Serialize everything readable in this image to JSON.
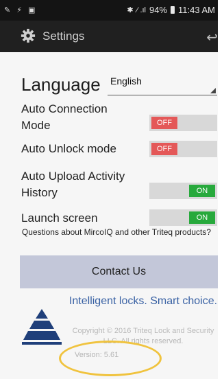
{
  "status_bar": {
    "left_icons": "✎ ⚡ ▣",
    "bluetooth": "✱",
    "signal": "⁄ .ıl",
    "battery_percent": "94%",
    "time": "11:43 AM"
  },
  "app_bar": {
    "title": "Settings",
    "icon": "gear-icon",
    "back_icon": "back-arrow-icon"
  },
  "language": {
    "label": "Language",
    "value": "English"
  },
  "settings": [
    {
      "label_line1": "Auto Connection",
      "label_line2": "Mode",
      "state": "OFF"
    },
    {
      "label_line1": "Auto Unlock mode",
      "label_line2": "",
      "state": "OFF"
    },
    {
      "label_line1": "Auto Upload Activity",
      "label_line2": "History",
      "state": "ON"
    },
    {
      "label_line1": "Launch screen",
      "label_line2": "",
      "state": "ON"
    }
  ],
  "questions_text": "Questions about MircoIQ and other Triteq products?",
  "contact_button": "Contact Us",
  "tagline": "Intelligent locks. Smart choice.",
  "copyright": "Copyright © 2016 Triteq Lock and Security LLC. All rights reserved.",
  "version": "Version: 5.61",
  "colors": {
    "off": "#e45858",
    "on": "#27a93c",
    "contact_bg": "#c3c7d9",
    "tagline": "#3a62a4",
    "highlight": "#f0c33e"
  }
}
